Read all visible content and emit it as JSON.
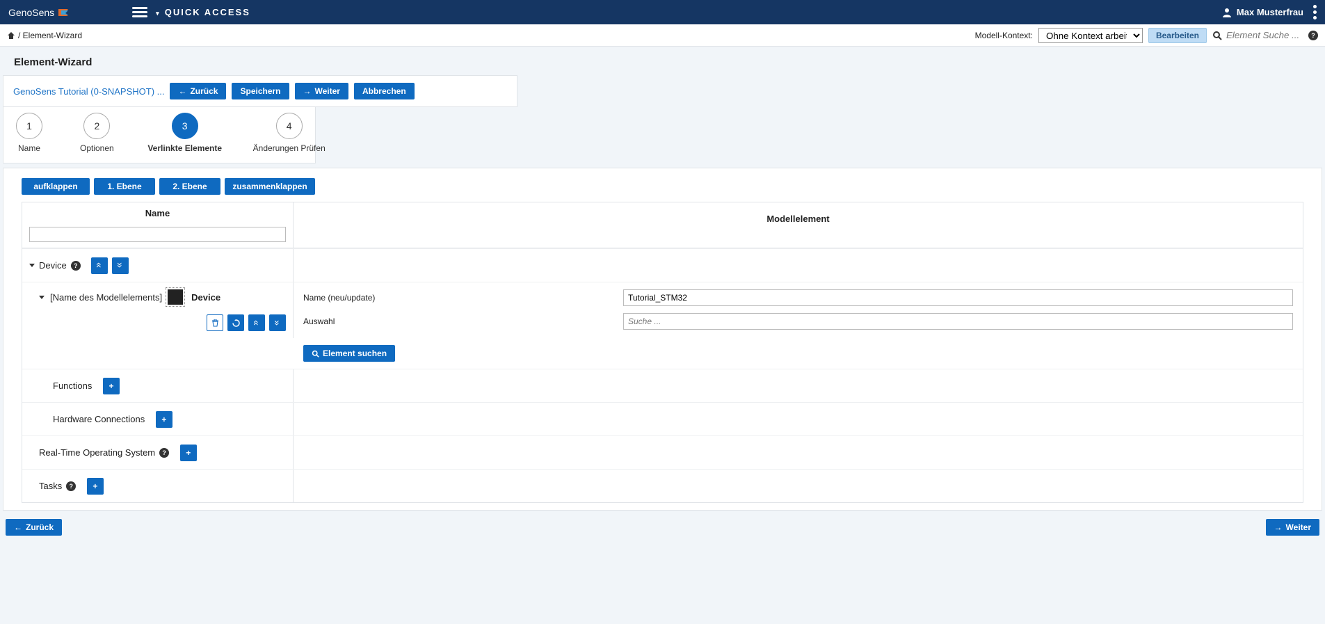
{
  "header": {
    "logo": "GenoSens",
    "quick_access": "QUICK ACCESS",
    "username": "Max Musterfrau"
  },
  "subbar": {
    "home_icon": "home-icon",
    "breadcrumb": "/ Element-Wizard",
    "context_label": "Modell-Kontext:",
    "context_value": "Ohne Kontext arbeiten",
    "edit_btn": "Bearbeiten",
    "search_placeholder": "Element Suche ..."
  },
  "page": {
    "title": "Element-Wizard"
  },
  "toolbar": {
    "project_link": "GenoSens Tutorial (0-SNAPSHOT) ...",
    "back": "Zurück",
    "save": "Speichern",
    "next": "Weiter",
    "cancel": "Abbrechen"
  },
  "steps": [
    {
      "num": "1",
      "label": "Name"
    },
    {
      "num": "2",
      "label": "Optionen"
    },
    {
      "num": "3",
      "label": "Verlinkte Elemente"
    },
    {
      "num": "4",
      "label": "Änderungen Prüfen"
    }
  ],
  "tree_actions": {
    "expand": "aufklappen",
    "level1": "1. Ebene",
    "level2": "2. Ebene",
    "collapse": "zusammenklappen"
  },
  "grid": {
    "head_name": "Name",
    "head_model": "Modellelement"
  },
  "device_row": {
    "label": "Device"
  },
  "element_row": {
    "placeholder_label": "[Name des Modellelements]",
    "type_label": "Device",
    "form_name_label": "Name (neu/update)",
    "form_name_value": "Tutorial_STM32",
    "form_auswahl_label": "Auswahl",
    "form_auswahl_placeholder": "Suche ...",
    "search_btn": "Element suchen"
  },
  "children": {
    "functions": "Functions",
    "hardware": "Hardware Connections",
    "rtos": "Real-Time Operating System",
    "tasks": "Tasks"
  },
  "footer": {
    "back": "Zurück",
    "next": "Weiter"
  }
}
